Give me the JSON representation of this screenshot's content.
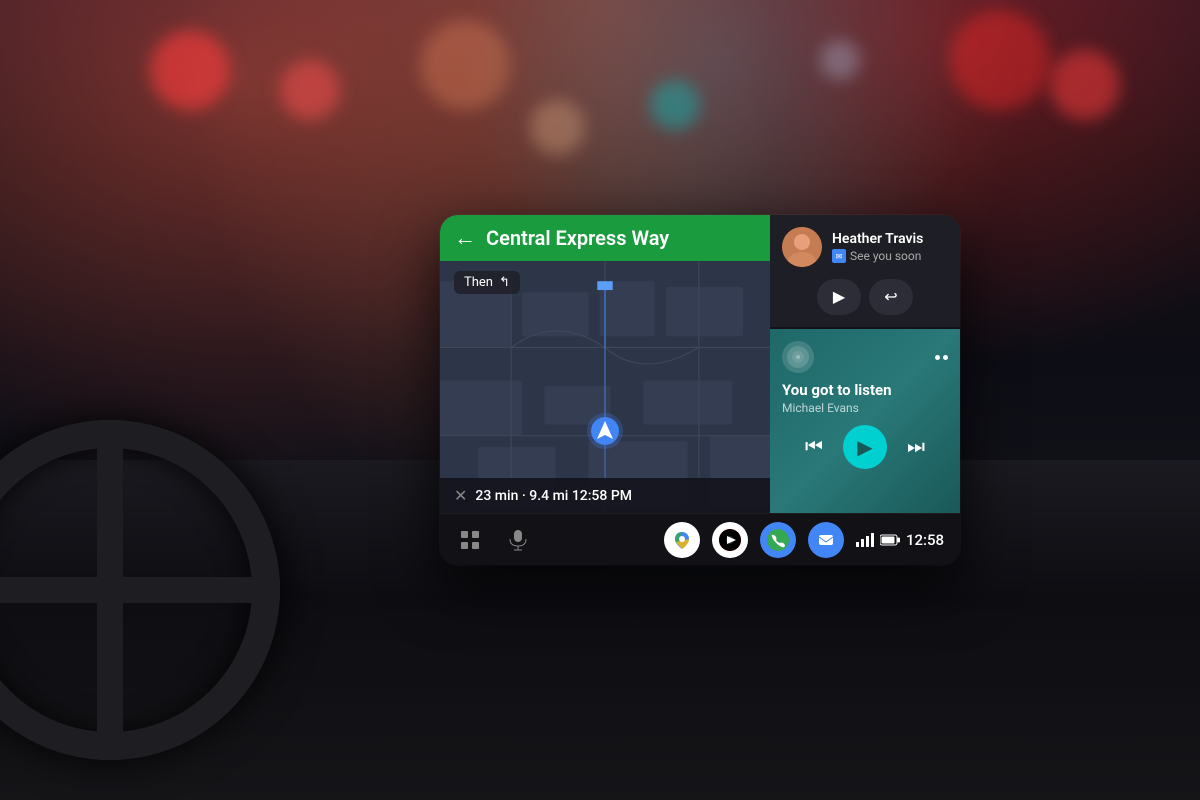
{
  "background": {
    "description": "Car interior dashboard with Android Auto screen"
  },
  "screen": {
    "navigation": {
      "direction_icon": "←",
      "street_name": "Central Express Way",
      "then_label": "Then",
      "then_icon": "↰",
      "eta_close_icon": "✕",
      "eta_time": "23 min",
      "eta_distance": "9.4 mi",
      "eta_clock": "12:58 PM"
    },
    "contact": {
      "name": "Heather Travis",
      "message": "See you soon",
      "play_button_label": "▶",
      "reply_button_label": "↩"
    },
    "music": {
      "title": "You got to listen",
      "artist": "Michael Evans",
      "prev_icon": "⏮",
      "play_icon": "▶",
      "next_icon": "⏭"
    },
    "taskbar": {
      "grid_icon": "⊞",
      "mic_icon": "🎤",
      "maps_icon": "📍",
      "youtube_icon": "▶",
      "phone_icon": "📞",
      "messages_icon": "💬",
      "time": "12:58"
    }
  }
}
